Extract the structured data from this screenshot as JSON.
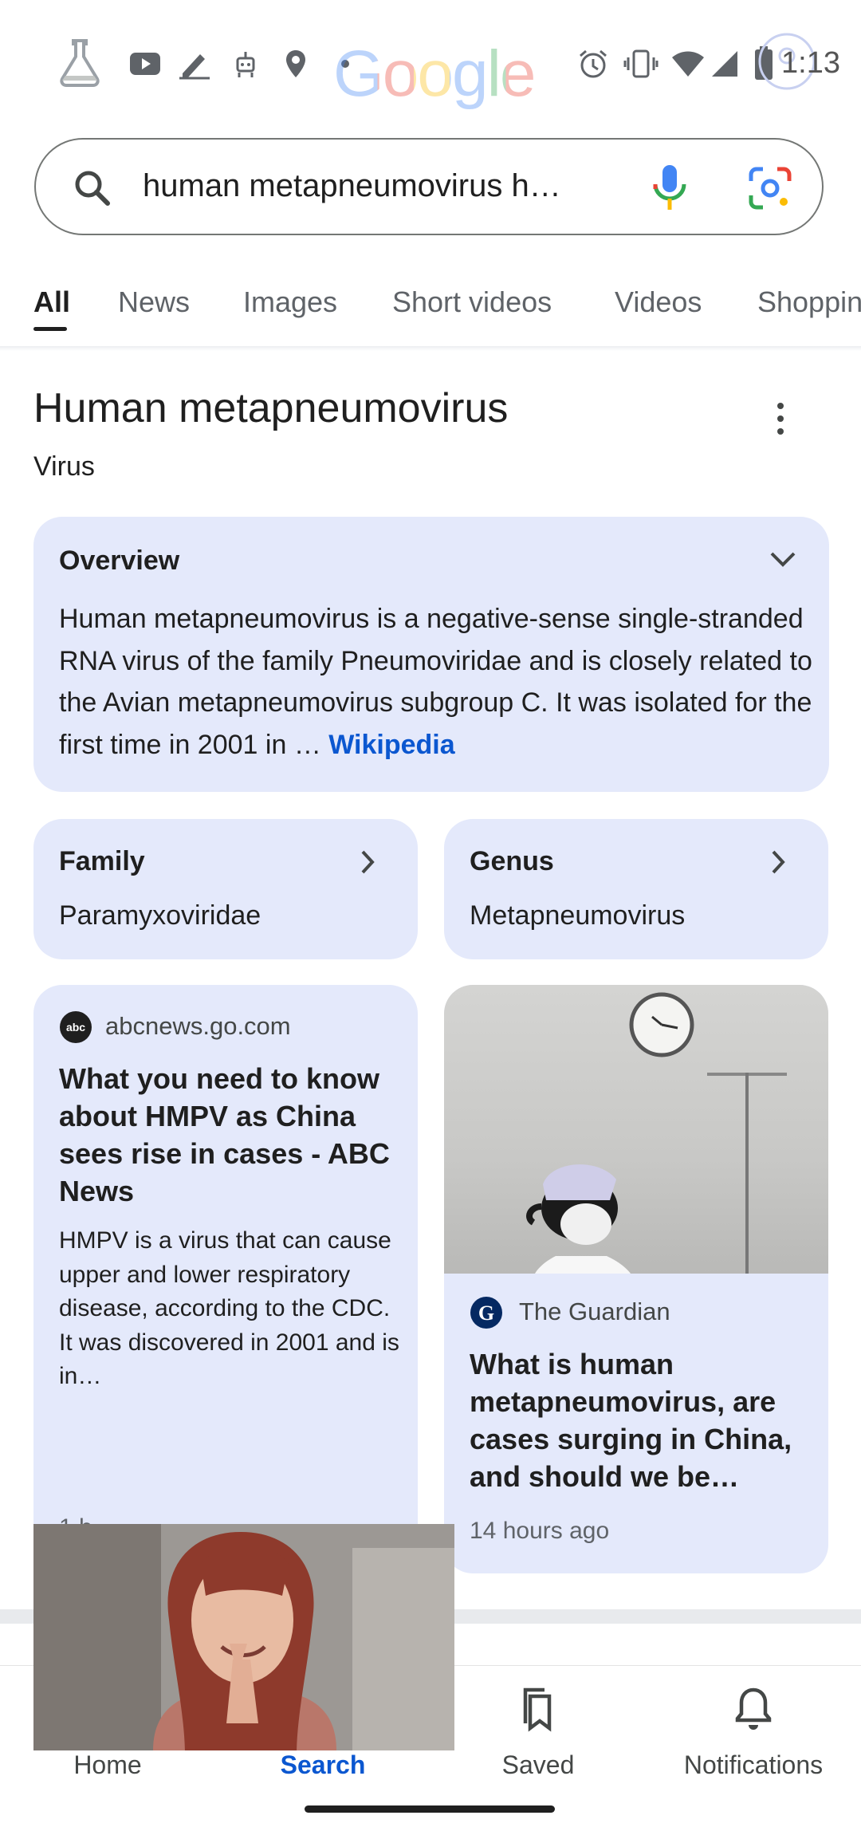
{
  "status_bar": {
    "time": "1:13",
    "google_logo": "Google",
    "icons": [
      "labs-flask-icon",
      "youtube-icon",
      "pen-icon",
      "robot-icon",
      "location-pin-icon",
      "dot-icon",
      "alarm-icon",
      "vibrate-icon",
      "wifi-icon",
      "signal-icon",
      "battery-icon",
      "circle-overlay-icon"
    ]
  },
  "search": {
    "query": "human metapneumovirus h…",
    "icons": [
      "search-icon",
      "mic-icon",
      "lens-icon"
    ]
  },
  "tabs": [
    {
      "label": "All",
      "active": true
    },
    {
      "label": "News"
    },
    {
      "label": "Images"
    },
    {
      "label": "Short videos"
    },
    {
      "label": "Videos"
    },
    {
      "label": "Shoppin"
    }
  ],
  "knowledge_panel": {
    "title": "Human metapneumovirus",
    "subtitle": "Virus",
    "overview": {
      "label": "Overview",
      "text": "Human metapneumovirus is a negative-sense single-stranded RNA virus of the family Pneumoviridae and is closely related to the Avian metapneumovirus subgroup C. It was isolated for the first time in 2001 in",
      "ellipsis": "…",
      "source": "Wikipedia"
    },
    "facts": [
      {
        "label": "Family",
        "value": "Paramyxoviridae"
      },
      {
        "label": "Genus",
        "value": "Metapneumovirus"
      }
    ]
  },
  "news": [
    {
      "source": "abcnews.go.com",
      "title": "What you need to know about HMPV as China sees rise in cases - ABC News",
      "snippet": "HMPV is a virus that can cause upper and lower respiratory disease, according to the CDC. It was discovered in 2001 and is in…",
      "time": "1 h"
    },
    {
      "source": "The Guardian",
      "title": "What is human metapneumovirus, are cases surging in China, and should we be…",
      "time": "14 hours ago"
    }
  ],
  "bottom_nav": [
    {
      "label": "Home",
      "icon": "home-icon"
    },
    {
      "label": "Search",
      "icon": "search-icon",
      "active": true
    },
    {
      "label": "Saved",
      "icon": "saved-bookmark-icon"
    },
    {
      "label": "Notifications",
      "icon": "bell-icon"
    }
  ],
  "colors": {
    "accent": "#0b57d0",
    "card_bg": "#e4e9fb",
    "text": "#1f1f1f"
  }
}
